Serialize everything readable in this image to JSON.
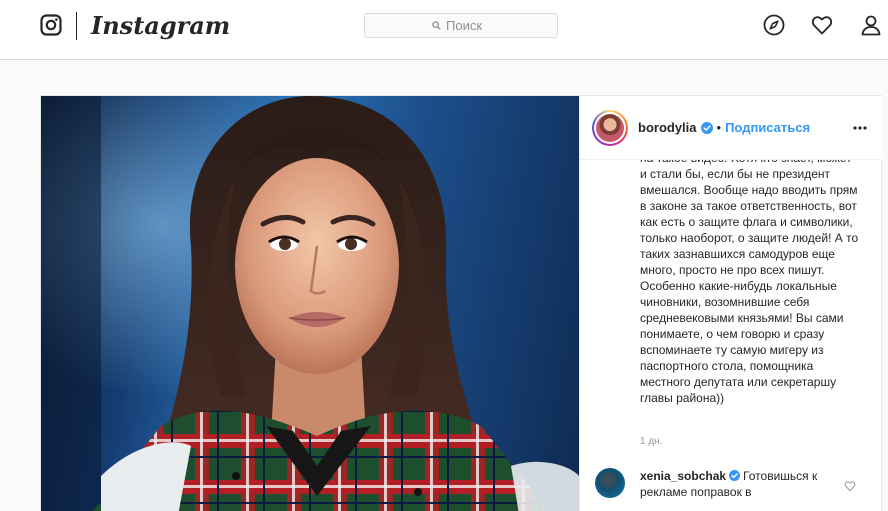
{
  "header": {
    "wordmark": "Instagram",
    "search_placeholder": "Поиск"
  },
  "post": {
    "owner": {
      "username": "borodylia",
      "separator": "•",
      "follow_label": "Подписаться"
    },
    "comments": [
      {
        "text": "на такое видео. Хотя кто знает, может и стали бы, если бы не президент вмешался. Вообще надо вводить прям в законе за такое ответственность, вот как есть о защите флага и символики, только наоборот, о защите людей! А то таких зазнавшихся самодуров еще много, просто не про всех пишут. Особенно какие-нибудь локальные чиновники, возомнившие себя средневековыми князьями! Вы сами понимаете, о чем говорю и сразу вспоминаете ту самую мигеру из паспортного стола, помощника местного депутата или секретаршу главы района))",
        "timestamp": "1 дн."
      },
      {
        "username": "xenia_sobchak",
        "text": "Готовишься к рекламе поправок в"
      }
    ]
  },
  "icons": {
    "logo": "instagram-glyph-icon",
    "search": "search-icon",
    "explore": "compass-icon",
    "activity": "heart-icon",
    "profile": "user-icon",
    "verified": "verified-badge-icon",
    "more": "more-options-icon",
    "like": "heart-outline-icon"
  },
  "colors": {
    "link_blue": "#3897f0",
    "text": "#262626",
    "muted": "#999999",
    "border": "#dbdbdb",
    "background": "#fafafa"
  }
}
